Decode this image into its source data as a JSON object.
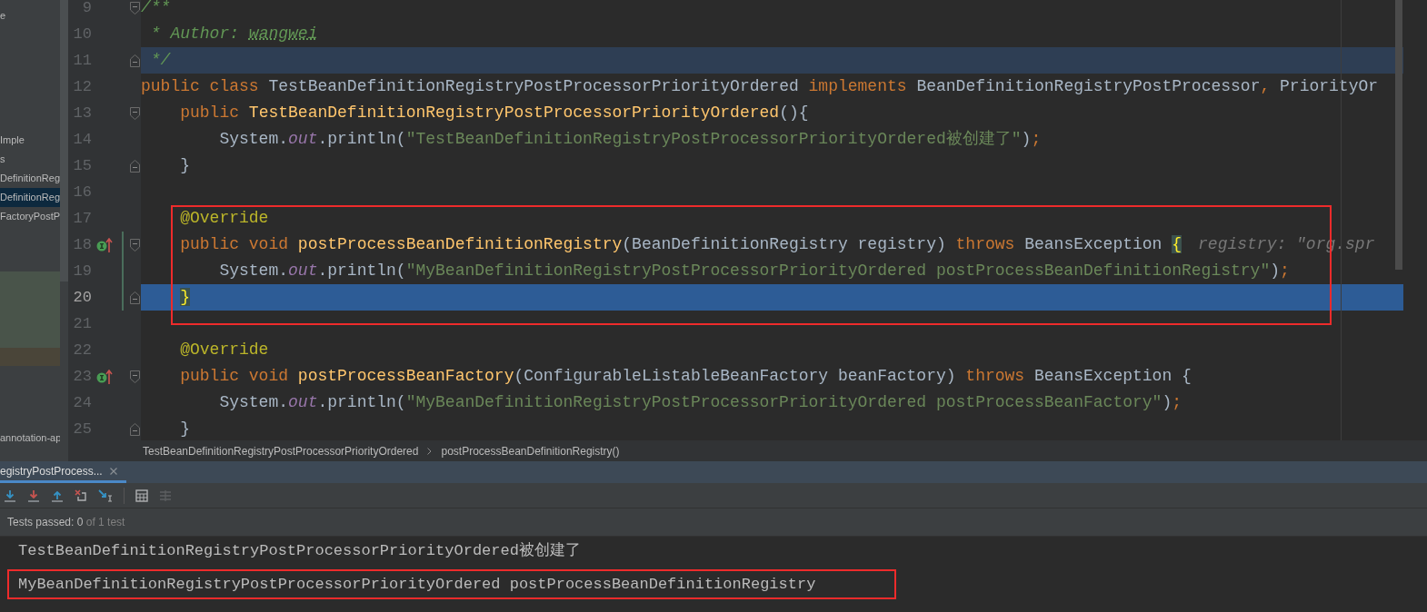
{
  "project_panel": {
    "items": [
      {
        "text": "e",
        "selected": false
      },
      {
        "text": "Imple",
        "selected": false
      },
      {
        "text": "s",
        "selected": false
      },
      {
        "text": "DefinitionReg",
        "selected": false
      },
      {
        "text": "DefinitionReg",
        "selected": true
      },
      {
        "text": "FactoryPostP",
        "selected": false
      }
    ],
    "footer_item": "annotation-ap"
  },
  "editor": {
    "lines": [
      {
        "number": "9",
        "fold_start": true,
        "fold_end": false,
        "marker": false,
        "changed": false,
        "highlighted": false,
        "current": false,
        "tokens": [
          {
            "kind": "doc",
            "text": "/**"
          }
        ]
      },
      {
        "number": "10",
        "fold_start": false,
        "fold_end": false,
        "marker": false,
        "changed": false,
        "highlighted": false,
        "current": false,
        "tokens": [
          {
            "kind": "doc",
            "text": " * Author: "
          },
          {
            "kind": "doc_typo",
            "text": "wangwei"
          }
        ]
      },
      {
        "number": "11",
        "fold_start": false,
        "fold_end": true,
        "marker": false,
        "changed": false,
        "highlighted": true,
        "current": false,
        "tokens": [
          {
            "kind": "doc",
            "text": " */"
          }
        ]
      },
      {
        "number": "12",
        "fold_start": false,
        "fold_end": false,
        "marker": false,
        "changed": false,
        "highlighted": false,
        "current": false,
        "tokens": [
          {
            "kind": "keyword",
            "text": "public class "
          },
          {
            "kind": "plain",
            "text": "TestBeanDefinitionRegistryPostProcessorPriorityOrdered "
          },
          {
            "kind": "keyword",
            "text": "implements "
          },
          {
            "kind": "plain",
            "text": "BeanDefinitionRegistryPostProcessor"
          },
          {
            "kind": "punct",
            "text": ", "
          },
          {
            "kind": "plain",
            "text": "PriorityOr"
          }
        ]
      },
      {
        "number": "13",
        "fold_start": true,
        "fold_end": false,
        "marker": false,
        "changed": false,
        "highlighted": false,
        "current": false,
        "tokens": [
          {
            "kind": "keyword",
            "text": "    public "
          },
          {
            "kind": "decl",
            "text": "TestBeanDefinitionRegistryPostProcessorPriorityOrdered"
          },
          {
            "kind": "plain",
            "text": "(){"
          }
        ]
      },
      {
        "number": "14",
        "fold_start": false,
        "fold_end": false,
        "marker": false,
        "changed": false,
        "highlighted": false,
        "current": false,
        "tokens": [
          {
            "kind": "plain",
            "text": "        System."
          },
          {
            "kind": "field",
            "text": "out"
          },
          {
            "kind": "plain",
            "text": ".println("
          },
          {
            "kind": "string",
            "text": "\"TestBeanDefinitionRegistryPostProcessorPriorityOrdered被创建了\""
          },
          {
            "kind": "plain",
            "text": ")"
          },
          {
            "kind": "punct",
            "text": ";"
          }
        ]
      },
      {
        "number": "15",
        "fold_start": false,
        "fold_end": true,
        "marker": false,
        "changed": false,
        "highlighted": false,
        "current": false,
        "tokens": [
          {
            "kind": "plain",
            "text": "    }"
          }
        ]
      },
      {
        "number": "16",
        "fold_start": false,
        "fold_end": false,
        "marker": false,
        "changed": false,
        "highlighted": false,
        "current": false
      },
      {
        "number": "17",
        "fold_start": false,
        "fold_end": false,
        "marker": false,
        "changed": false,
        "highlighted": false,
        "current": false,
        "tokens": [
          {
            "kind": "annotation",
            "text": "    @Override"
          }
        ]
      },
      {
        "number": "18",
        "fold_start": true,
        "fold_end": false,
        "marker": true,
        "changed": true,
        "highlighted": false,
        "current": false,
        "tokens": [
          {
            "kind": "keyword",
            "text": "    public void "
          },
          {
            "kind": "decl",
            "text": "postProcessBeanDefinitionRegistry"
          },
          {
            "kind": "plain",
            "text": "(BeanDefinitionRegistry registry) "
          },
          {
            "kind": "keyword",
            "text": "throws "
          },
          {
            "kind": "plain",
            "text": "BeansException "
          },
          {
            "kind": "brace",
            "text": "{"
          }
        ],
        "hint": "registry: \"org.spr"
      },
      {
        "number": "19",
        "fold_start": false,
        "fold_end": false,
        "marker": false,
        "changed": true,
        "highlighted": false,
        "current": false,
        "tokens": [
          {
            "kind": "plain",
            "text": "        System."
          },
          {
            "kind": "field",
            "text": "out"
          },
          {
            "kind": "plain",
            "text": ".println("
          },
          {
            "kind": "string",
            "text": "\"MyBeanDefinitionRegistryPostProcessorPriorityOrdered postProcessBeanDefinitionRegistry\""
          },
          {
            "kind": "plain",
            "text": ")"
          },
          {
            "kind": "punct",
            "text": ";"
          }
        ]
      },
      {
        "number": "20",
        "fold_start": false,
        "fold_end": true,
        "marker": false,
        "changed": true,
        "highlighted": true,
        "current": true,
        "tokens": [
          {
            "kind": "brace_indent",
            "text": "}"
          }
        ]
      },
      {
        "number": "21",
        "fold_start": false,
        "fold_end": false,
        "marker": false,
        "changed": false,
        "highlighted": false,
        "current": false
      },
      {
        "number": "22",
        "fold_start": false,
        "fold_end": false,
        "marker": false,
        "changed": false,
        "highlighted": false,
        "current": false,
        "tokens": [
          {
            "kind": "annotation",
            "text": "    @Override"
          }
        ]
      },
      {
        "number": "23",
        "fold_start": true,
        "fold_end": false,
        "marker": true,
        "changed": false,
        "highlighted": false,
        "current": false,
        "tokens": [
          {
            "kind": "keyword",
            "text": "    public void "
          },
          {
            "kind": "decl",
            "text": "postProcessBeanFactory"
          },
          {
            "kind": "plain",
            "text": "(ConfigurableListableBeanFactory beanFactory) "
          },
          {
            "kind": "keyword",
            "text": "throws "
          },
          {
            "kind": "plain",
            "text": "BeansException {"
          }
        ]
      },
      {
        "number": "24",
        "fold_start": false,
        "fold_end": false,
        "marker": false,
        "changed": false,
        "highlighted": false,
        "current": false,
        "tokens": [
          {
            "kind": "plain",
            "text": "        System."
          },
          {
            "kind": "field",
            "text": "out"
          },
          {
            "kind": "plain",
            "text": ".println("
          },
          {
            "kind": "string",
            "text": "\"MyBeanDefinitionRegistryPostProcessorPriorityOrdered postProcessBeanFactory\""
          },
          {
            "kind": "plain",
            "text": ")"
          },
          {
            "kind": "punct",
            "text": ";"
          }
        ]
      },
      {
        "number": "25",
        "fold_start": false,
        "fold_end": true,
        "marker": false,
        "changed": false,
        "highlighted": false,
        "current": false,
        "tokens": [
          {
            "kind": "plain",
            "text": "    }"
          }
        ]
      }
    ]
  },
  "breadcrumbs": [
    {
      "text": "TestBeanDefinitionRegistryPostProcessorPriorityOrdered"
    },
    {
      "text": "postProcessBeanDefinitionRegistry()"
    }
  ],
  "run_panel": {
    "tab": {
      "label": "egistryPostProcess...",
      "selected": true
    },
    "toolbar": [
      {
        "kind": "next_down"
      },
      {
        "kind": "prev_down"
      },
      {
        "kind": "up"
      },
      {
        "kind": "stop_box"
      },
      {
        "kind": "jump"
      },
      {
        "kind": "separator"
      },
      {
        "kind": "table"
      },
      {
        "kind": "list_disabled"
      }
    ],
    "status": {
      "passed": "Tests passed: 0",
      "total": "of 1 test"
    },
    "console": [
      {
        "text": "TestBeanDefinitionRegistryPostProcessorPriorityOrdered被创建了",
        "framed": false
      },
      {
        "text": "MyBeanDefinitionRegistryPostProcessorPriorityOrdered postProcessBeanDefinitionRegistry",
        "framed": true
      }
    ]
  }
}
